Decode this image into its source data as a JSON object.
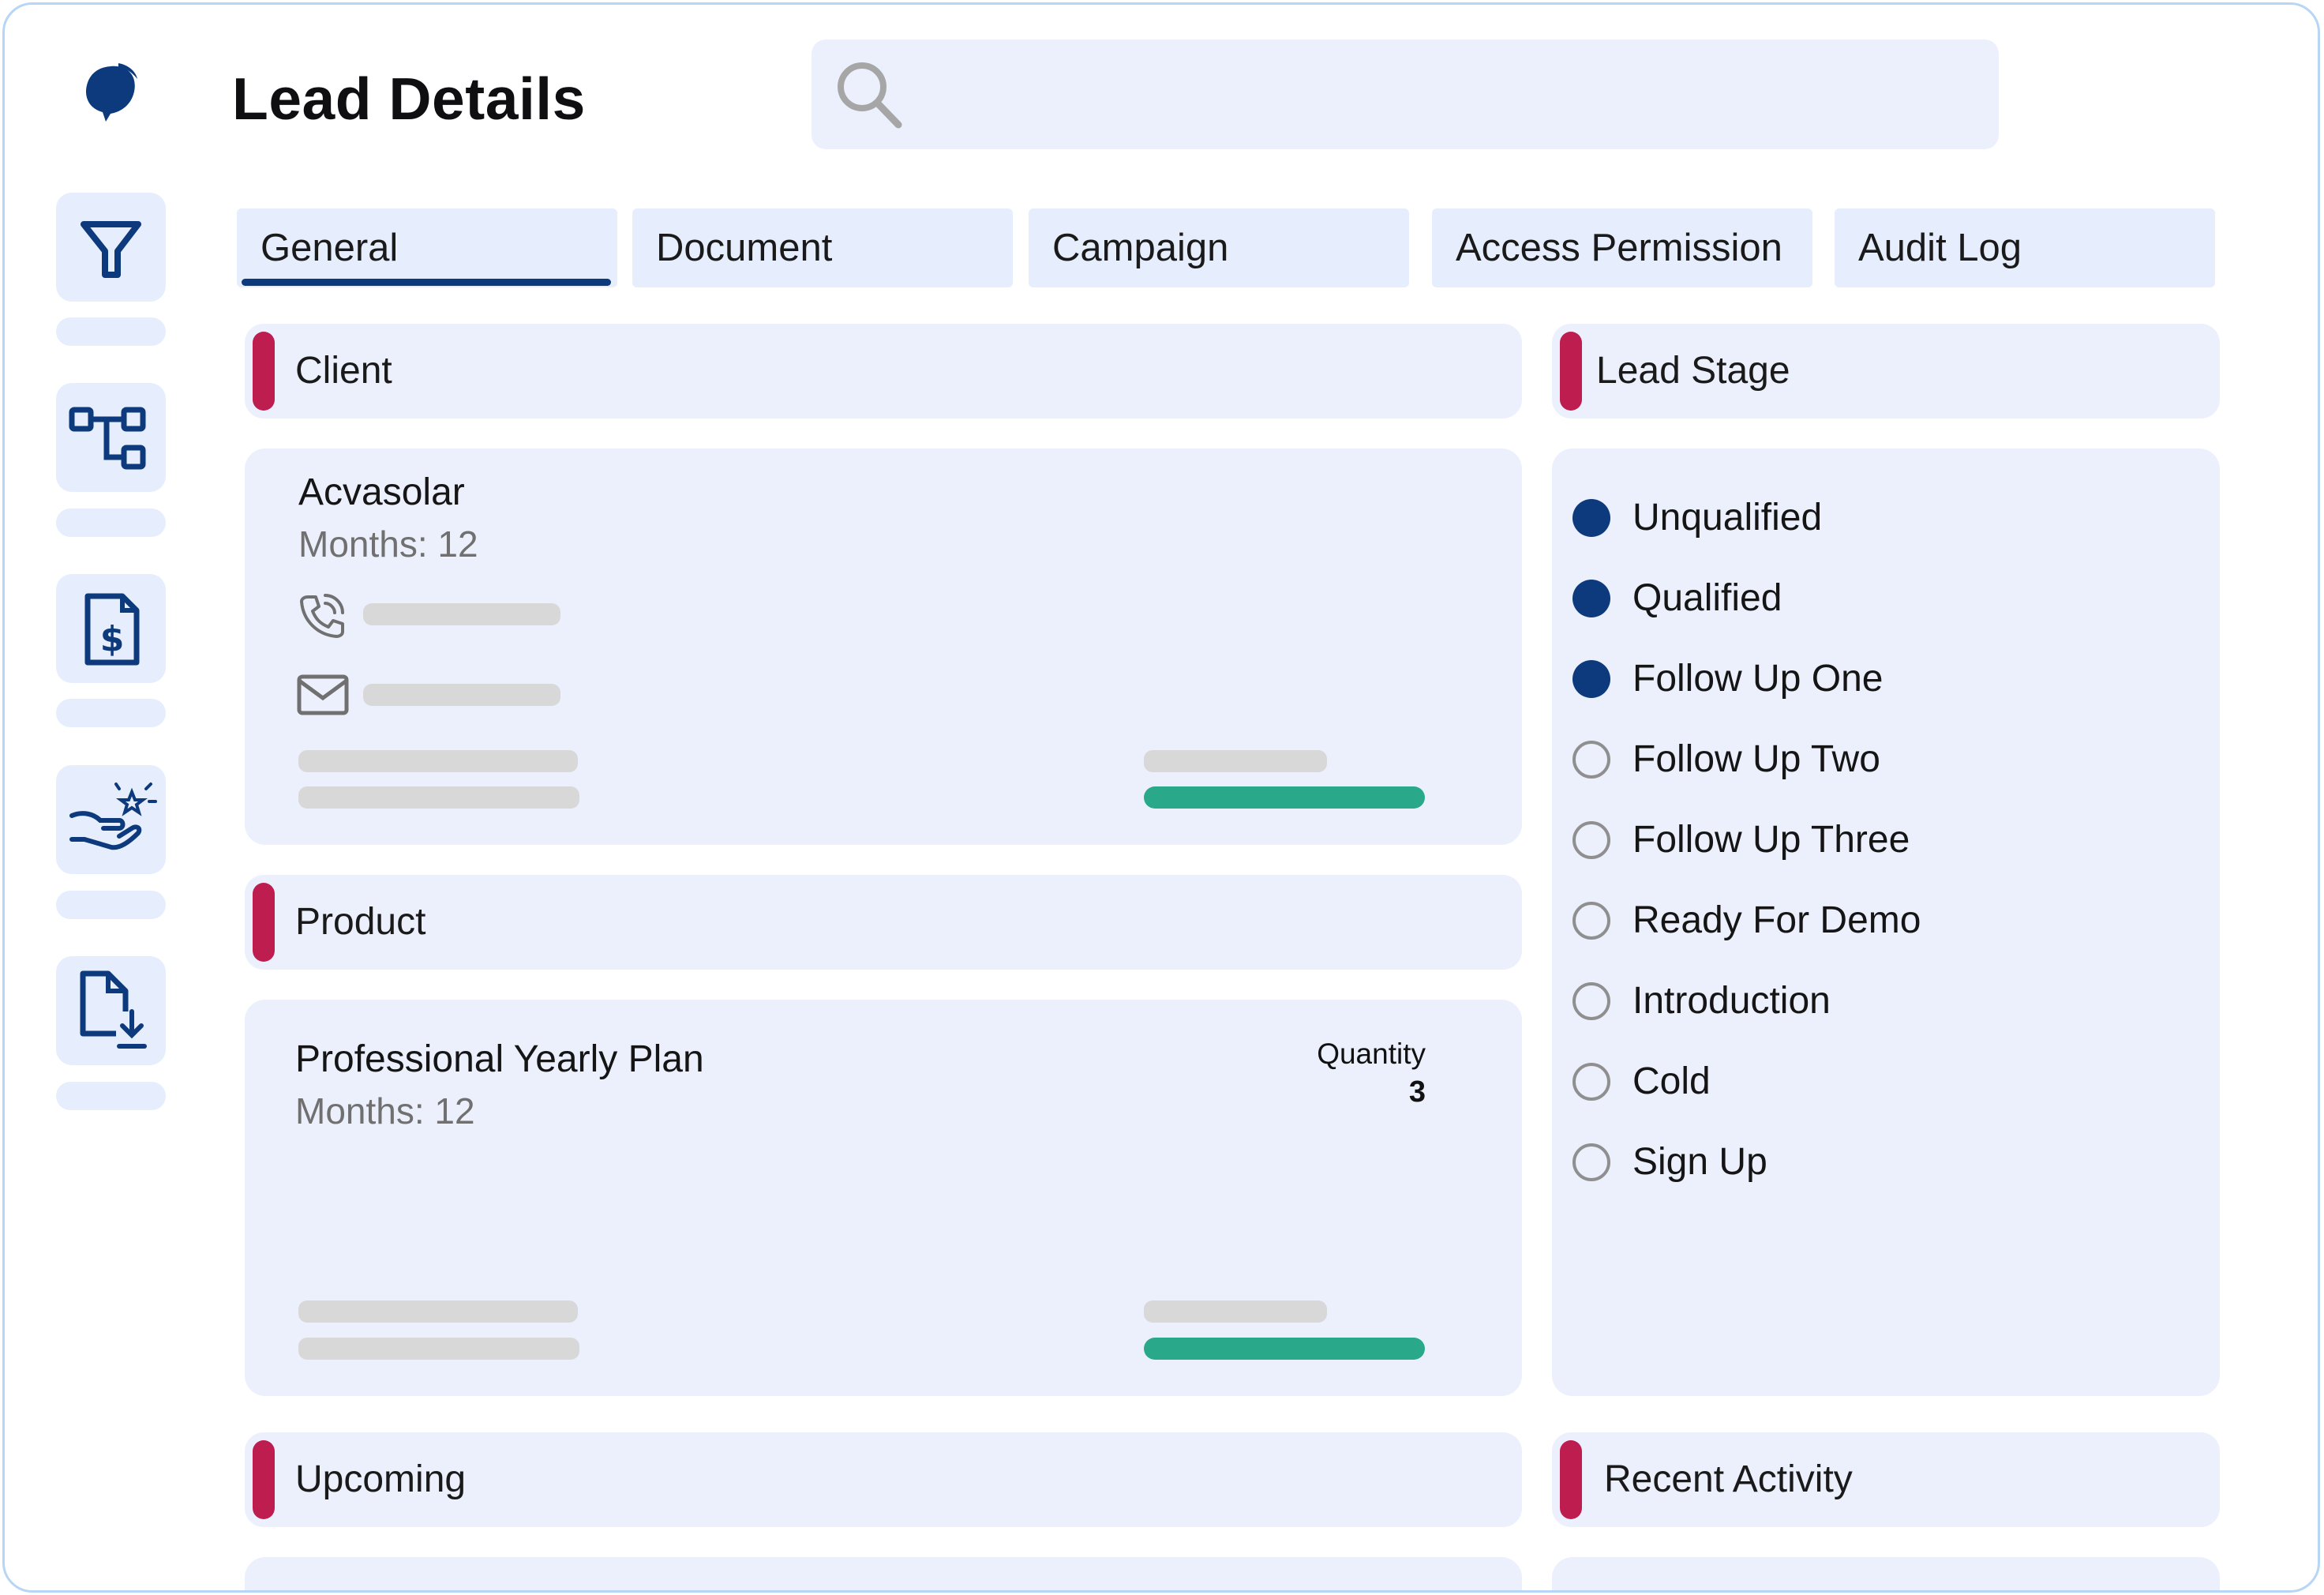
{
  "header": {
    "title": "Lead Details",
    "search_placeholder": "",
    "logo_icon": "leaf-bubble-logo-icon"
  },
  "sidebar": {
    "items": [
      {
        "icon": "filter-icon"
      },
      {
        "icon": "hierarchy-icon"
      },
      {
        "icon": "invoice-dollar-icon"
      },
      {
        "icon": "hand-star-icon"
      },
      {
        "icon": "file-download-icon"
      }
    ]
  },
  "tabs": [
    {
      "label": "General",
      "active": true
    },
    {
      "label": "Document",
      "active": false
    },
    {
      "label": "Campaign",
      "active": false
    },
    {
      "label": "Access Permission",
      "active": false
    },
    {
      "label": "Audit Log",
      "active": false
    }
  ],
  "client": {
    "section_title": "Client",
    "name": "Acvasolar",
    "months": "Months: 12",
    "phone_icon": "phone-icon",
    "email_icon": "mail-icon"
  },
  "product": {
    "section_title": "Product",
    "name": "Professional Yearly Plan",
    "months": "Months: 12",
    "quantity_label": "Quantity",
    "quantity_value": "3"
  },
  "lead_stage": {
    "section_title": "Lead Stage",
    "stages": [
      {
        "label": "Unqualified",
        "completed": true
      },
      {
        "label": "Qualified",
        "completed": true
      },
      {
        "label": "Follow Up One",
        "completed": true
      },
      {
        "label": "Follow Up Two",
        "completed": false
      },
      {
        "label": "Follow Up Three",
        "completed": false
      },
      {
        "label": "Ready For Demo",
        "completed": false
      },
      {
        "label": "Introduction",
        "completed": false
      },
      {
        "label": "Cold",
        "completed": false
      },
      {
        "label": "Sign Up",
        "completed": false
      }
    ]
  },
  "upcoming": {
    "section_title": "Upcoming"
  },
  "recent_activity": {
    "section_title": "Recent Activity"
  },
  "colors": {
    "accent": "#be1e4f",
    "primary": "#0c3a7c",
    "success": "#2aa98a",
    "panel": "#ecf0fd"
  }
}
